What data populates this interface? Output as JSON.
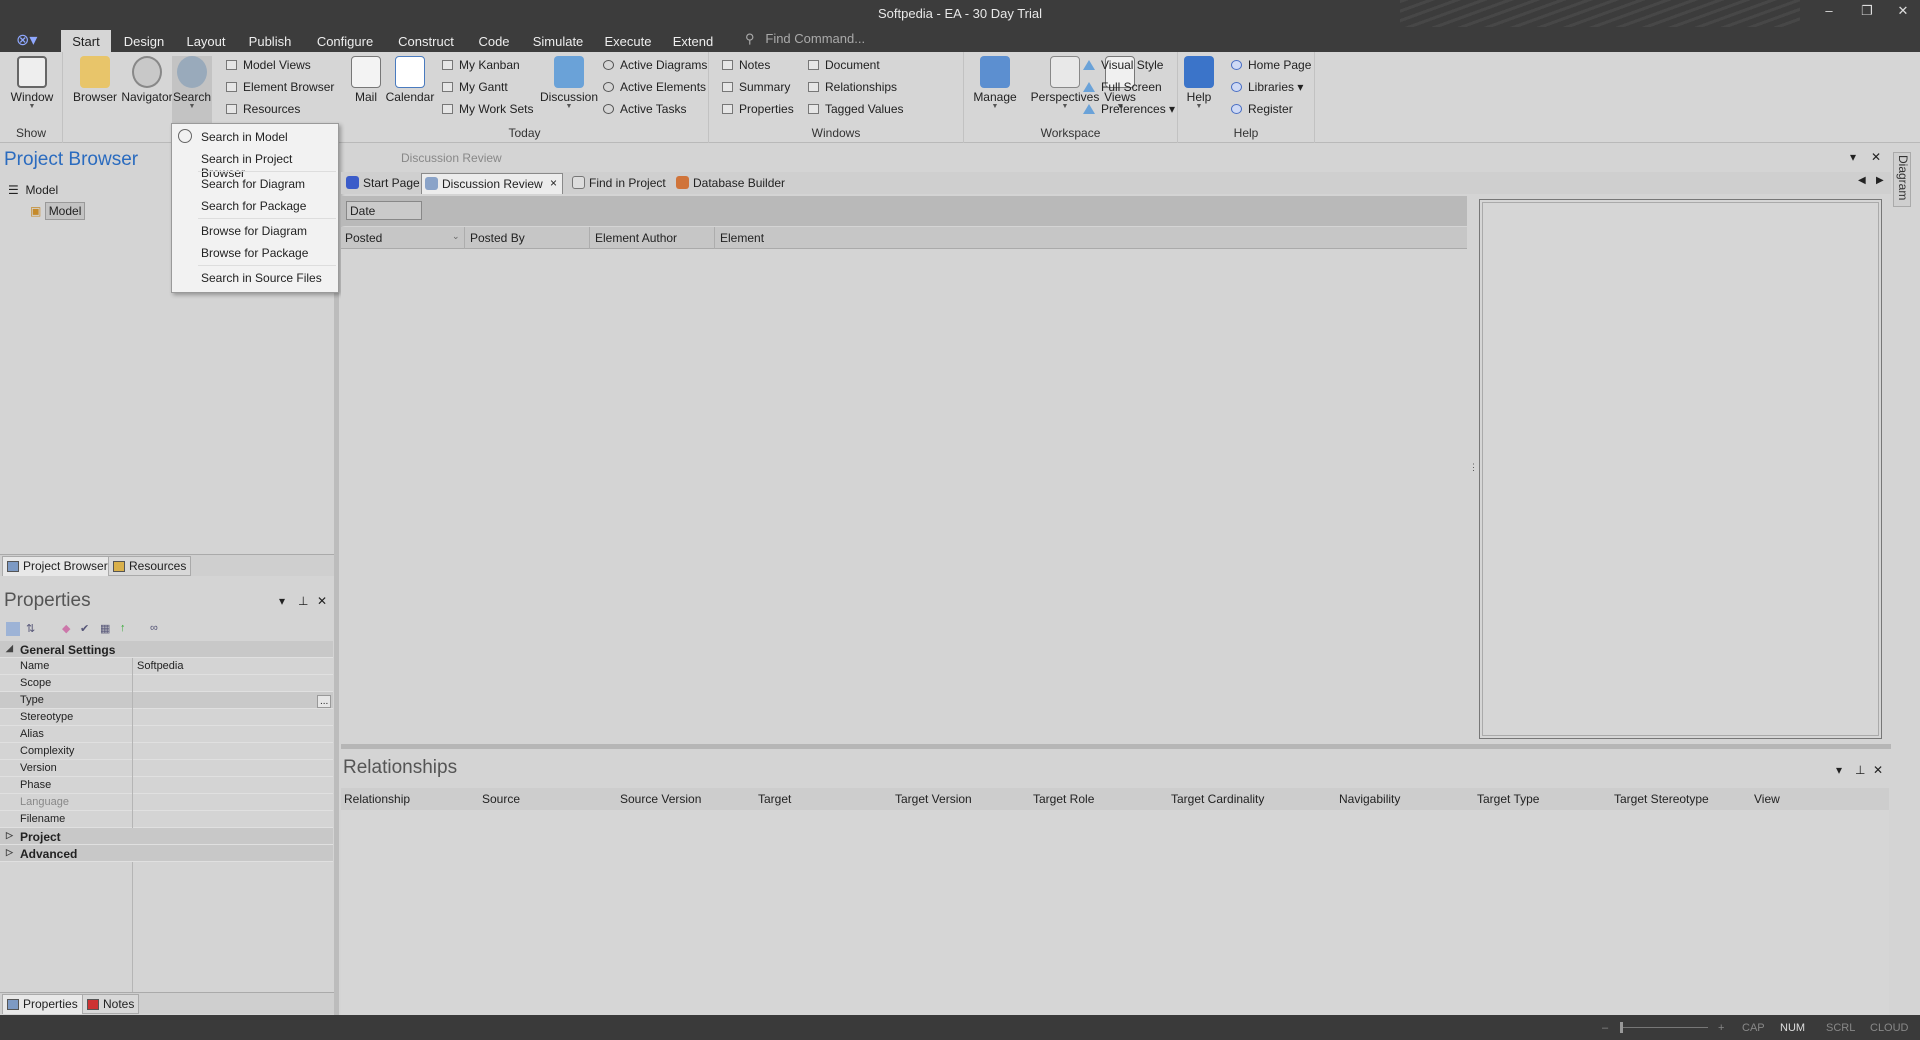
{
  "app": {
    "title": "Softpedia - EA - 30 Day Trial"
  },
  "menu": {
    "tabs": [
      "Start",
      "Design",
      "Layout",
      "Publish",
      "Configure",
      "Construct",
      "Code",
      "Simulate",
      "Execute",
      "Extend"
    ],
    "find_command": "Find Command..."
  },
  "ribbon": {
    "show": {
      "label": "Show",
      "window": "Window"
    },
    "explore": {
      "browser": "Browser",
      "navigator": "Navigator",
      "search": "Search",
      "model_views": "Model Views",
      "element_browser": "Element Browser",
      "resources": "Resources"
    },
    "today": {
      "label": "Today",
      "mail": "Mail",
      "calendar": "Calendar",
      "my_kanban": "My Kanban",
      "my_gantt": "My Gantt",
      "my_work_sets": "My Work Sets",
      "discussion": "Discussion",
      "active_diagrams": "Active Diagrams",
      "active_elements": "Active Elements",
      "active_tasks": "Active Tasks"
    },
    "windows": {
      "label": "Windows",
      "notes": "Notes",
      "summary": "Summary",
      "properties": "Properties",
      "document": "Document",
      "relationships": "Relationships",
      "tagged_values": "Tagged Values"
    },
    "workspace": {
      "label": "Workspace",
      "manage": "Manage",
      "perspectives": "Perspectives",
      "views": "Views",
      "visual_style": "Visual Style",
      "full_screen": "Full Screen",
      "preferences": "Preferences"
    },
    "help": {
      "label": "Help",
      "help": "Help",
      "home_page": "Home Page",
      "libraries": "Libraries",
      "register": "Register"
    }
  },
  "search_menu": {
    "items": [
      "Search in Model",
      "Search in Project Browser",
      "Search for Diagram",
      "Search for Package",
      "Browse for Diagram",
      "Browse for Package",
      "Search in Source Files"
    ]
  },
  "project_browser": {
    "title": "Project Browser",
    "root": "Model",
    "child": "Model",
    "tabs": [
      "Project Browser",
      "Resources"
    ]
  },
  "properties": {
    "title": "Properties",
    "general": "General Settings",
    "rows": [
      {
        "k": "Name",
        "v": "Softpedia"
      },
      {
        "k": "Scope",
        "v": ""
      },
      {
        "k": "Type",
        "v": ""
      },
      {
        "k": "Stereotype",
        "v": ""
      },
      {
        "k": "Alias",
        "v": ""
      },
      {
        "k": "Complexity",
        "v": ""
      },
      {
        "k": "Version",
        "v": ""
      },
      {
        "k": "Phase",
        "v": ""
      },
      {
        "k": "Language",
        "v": ""
      },
      {
        "k": "Filename",
        "v": ""
      }
    ],
    "project": "Project",
    "advanced": "Advanced",
    "ellipsis": "...",
    "tabs": [
      "Properties",
      "Notes"
    ]
  },
  "discussion": {
    "title": "Discussion Review",
    "tabs": [
      "Start Page",
      "Discussion Review",
      "Find in Project",
      "Database Builder"
    ],
    "close": "×",
    "filter": "Date",
    "columns": [
      "Posted",
      "Posted By",
      "Element Author",
      "Element"
    ]
  },
  "diagram_tab": "Diagram",
  "relationships": {
    "title": "Relationships",
    "columns": [
      "Relationship",
      "Source",
      "Source Version",
      "Target",
      "Target Version",
      "Target Role",
      "Target Cardinality",
      "Navigability",
      "Target Type",
      "Target Stereotype",
      "View"
    ]
  },
  "status": {
    "cap": "CAP",
    "num": "NUM",
    "scrl": "SCRL",
    "cloud": "CLOUD",
    "minus": "–",
    "plus": "+"
  }
}
